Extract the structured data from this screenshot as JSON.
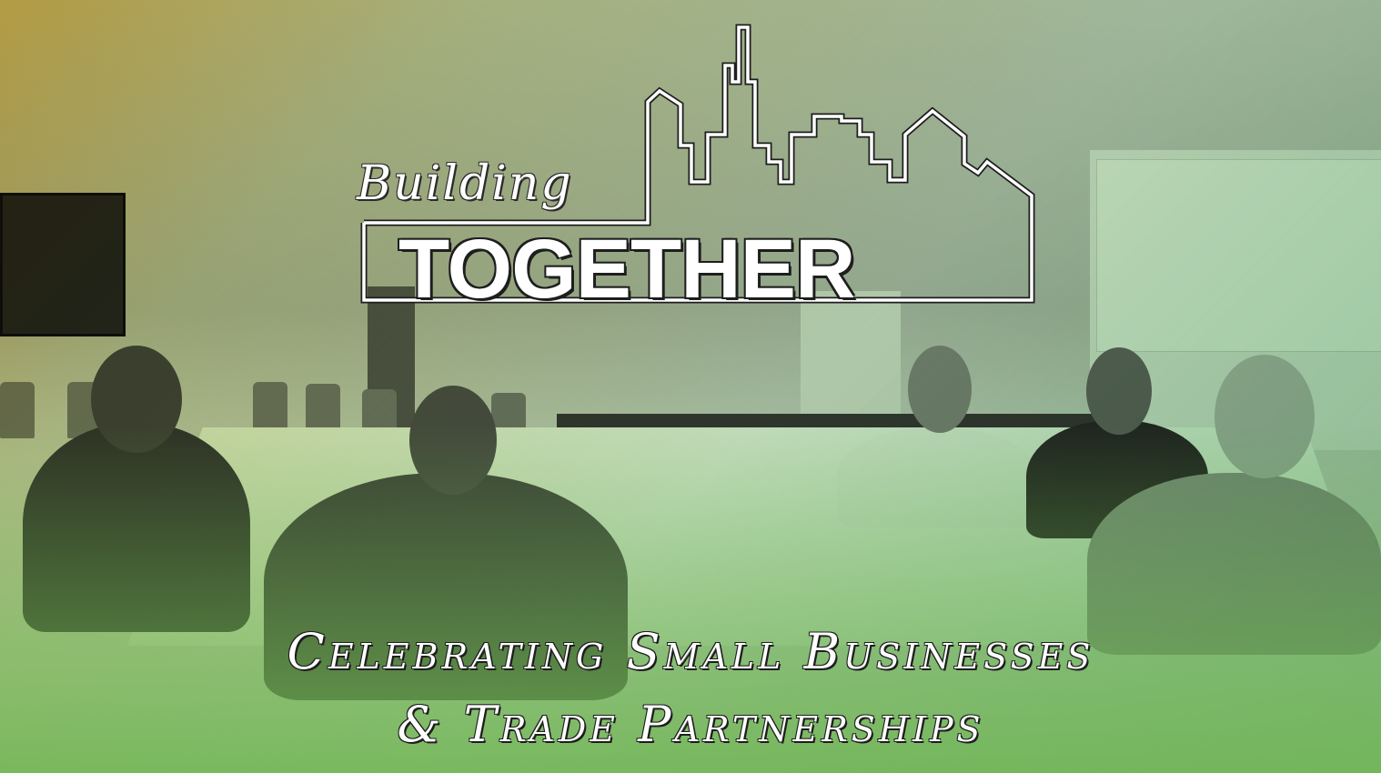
{
  "graphic": {
    "title_top": "Building",
    "title_main": "TOGETHER",
    "subtitle_line1": "Celebrating Small Businesses",
    "subtitle_line2": "& Trade Partnerships"
  },
  "colors": {
    "tint_yellow": "#d6b434",
    "tint_green": "#3ca050",
    "text": "#ffffff",
    "outline": "#1e1e1e"
  },
  "icons": [
    "city-skyline-icon"
  ]
}
